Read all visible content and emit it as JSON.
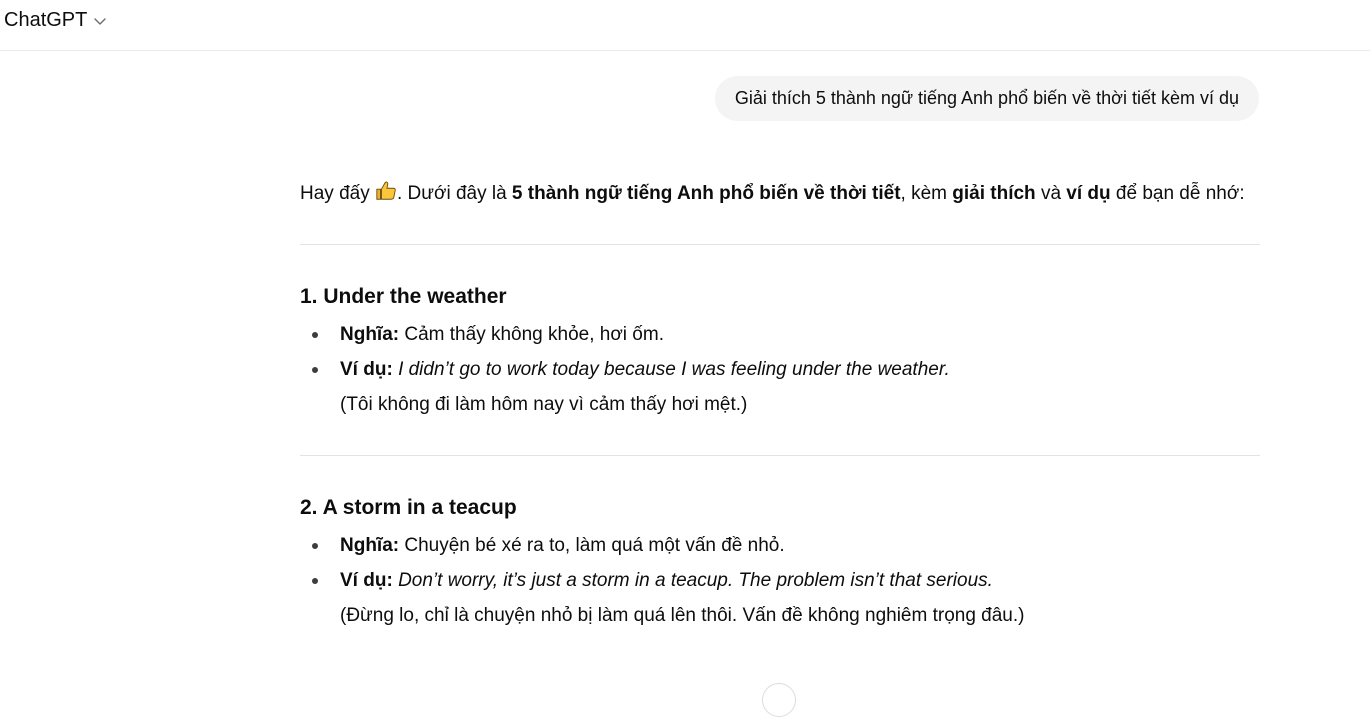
{
  "header": {
    "model_name": "ChatGPT",
    "dropdown_icon": "chevron-down-icon"
  },
  "user_message": {
    "text": "Giải thích 5 thành ngữ tiếng Anh phổ biến về thời tiết kèm ví dụ"
  },
  "answer": {
    "intro": {
      "part1": "Hay đấy ",
      "emoji": "thumbs-up-emoji",
      "part2": ". Dưới đây là ",
      "bold1": "5 thành ngữ tiếng Anh phổ biến về thời tiết",
      "part3": ", kèm ",
      "bold2": "giải thích",
      "part4": " và ",
      "bold3": "ví dụ",
      "part5": " để bạn dễ nhớ:"
    },
    "idioms": [
      {
        "title": "1. Under the weather",
        "meaning_label": "Nghĩa:",
        "meaning": " Cảm thấy không khỏe, hơi ốm.",
        "example_label": "Ví dụ:",
        "example": "I didn’t go to work today because I was feeling under the weather.",
        "translation": "(Tôi không đi làm hôm nay vì cảm thấy hơi mệt.)"
      },
      {
        "title": "2. A storm in a teacup",
        "meaning_label": "Nghĩa:",
        "meaning": " Chuyện bé xé ra to, làm quá một vấn đề nhỏ.",
        "example_label": "Ví dụ:",
        "example": "Don’t worry, it’s just a storm in a teacup. The problem isn’t that serious.",
        "translation": "(Đừng lo, chỉ là chuyện nhỏ bị làm quá lên thôi. Vấn đề không nghiêm trọng đâu.)"
      }
    ]
  },
  "colors": {
    "text": "#0d0d0d",
    "bubble_bg": "#f4f4f4",
    "divider": "#e3e3e3"
  }
}
